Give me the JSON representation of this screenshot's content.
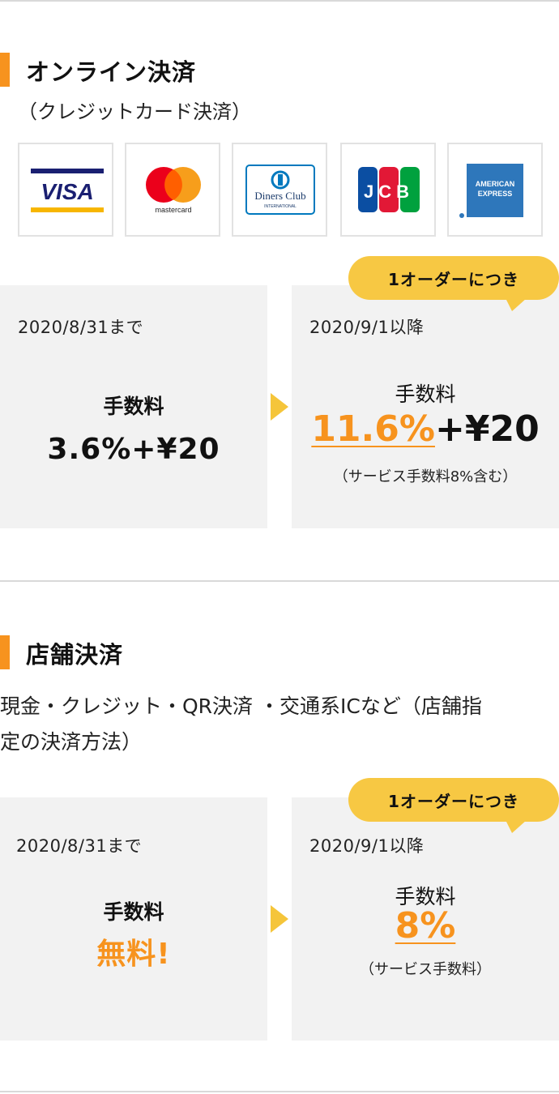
{
  "online": {
    "title": "オンライン決済",
    "subtitle": "（クレジットカード決済）",
    "cards": [
      {
        "name": "visa-logo",
        "label": "VISA"
      },
      {
        "name": "mastercard-logo",
        "label": "mastercard"
      },
      {
        "name": "diners-logo",
        "label": "Diners Club",
        "sub": "INTERNATIONAL"
      },
      {
        "name": "jcb-logo",
        "label": "JCB"
      },
      {
        "name": "amex-logo",
        "label": "AMERICAN",
        "sub": "EXPRESS"
      }
    ],
    "bubble": "1オーダーにつき",
    "before": {
      "date": "2020/8/31まで",
      "label": "手数料",
      "value": "3.6%+¥20"
    },
    "after": {
      "date": "2020/9/1以降",
      "label": "手数料",
      "value_highlight": "11.6%",
      "value_rest": "+¥20",
      "note": "（サービス手数料8%含む）"
    }
  },
  "store": {
    "title": "店舗決済",
    "subtitle_line1": "現金・クレジット・QR決済 ・交通系ICなど（店舗指",
    "subtitle_line2": "定の決済方法）",
    "bubble": "1オーダーにつき",
    "before": {
      "date": "2020/8/31まで",
      "label": "手数料",
      "value": "無料!"
    },
    "after": {
      "date": "2020/9/1以降",
      "label": "手数料",
      "value_highlight": "8%",
      "note": "（サービス手数料）"
    }
  },
  "colors": {
    "accent": "#f7931e",
    "bubble": "#f7c843",
    "arrow": "#f5c53a",
    "panel": "#f2f2f2"
  }
}
